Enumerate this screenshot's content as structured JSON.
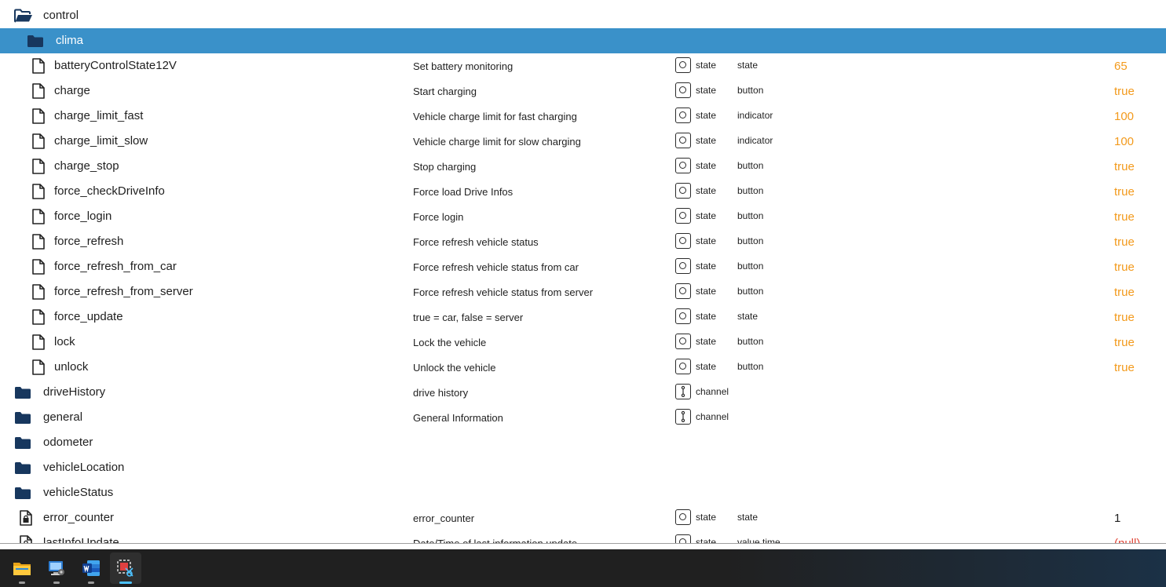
{
  "tree": [
    {
      "indent": 0,
      "icon": "folder-open",
      "name": "control",
      "desc": "",
      "type": "",
      "role": "",
      "value": "",
      "valueColor": ""
    },
    {
      "indent": 1,
      "icon": "folder",
      "name": "clima",
      "desc": "",
      "type": "",
      "role": "",
      "value": "",
      "valueColor": "",
      "selected": true
    },
    {
      "indent": 2,
      "icon": "file",
      "name": "batteryControlState12V",
      "desc": "Set battery monitoring",
      "type": "state",
      "role": "state",
      "value": "65",
      "valueColor": "orange"
    },
    {
      "indent": 2,
      "icon": "file",
      "name": "charge",
      "desc": "Start charging",
      "type": "state",
      "role": "button",
      "value": "true",
      "valueColor": "orange"
    },
    {
      "indent": 2,
      "icon": "file",
      "name": "charge_limit_fast",
      "desc": "Vehicle charge limit for fast charging",
      "type": "state",
      "role": "indicator",
      "value": "100",
      "valueColor": "orange"
    },
    {
      "indent": 2,
      "icon": "file",
      "name": "charge_limit_slow",
      "desc": "Vehicle charge limit for slow charging",
      "type": "state",
      "role": "indicator",
      "value": "100",
      "valueColor": "orange"
    },
    {
      "indent": 2,
      "icon": "file",
      "name": "charge_stop",
      "desc": "Stop charging",
      "type": "state",
      "role": "button",
      "value": "true",
      "valueColor": "orange"
    },
    {
      "indent": 2,
      "icon": "file",
      "name": "force_checkDriveInfo",
      "desc": "Force load Drive Infos",
      "type": "state",
      "role": "button",
      "value": "true",
      "valueColor": "orange"
    },
    {
      "indent": 2,
      "icon": "file",
      "name": "force_login",
      "desc": "Force login",
      "type": "state",
      "role": "button",
      "value": "true",
      "valueColor": "orange"
    },
    {
      "indent": 2,
      "icon": "file",
      "name": "force_refresh",
      "desc": "Force refresh vehicle status",
      "type": "state",
      "role": "button",
      "value": "true",
      "valueColor": "orange"
    },
    {
      "indent": 2,
      "icon": "file",
      "name": "force_refresh_from_car",
      "desc": "Force refresh vehicle status from car",
      "type": "state",
      "role": "button",
      "value": "true",
      "valueColor": "orange"
    },
    {
      "indent": 2,
      "icon": "file",
      "name": "force_refresh_from_server",
      "desc": "Force refresh vehicle status from server",
      "type": "state",
      "role": "button",
      "value": "true",
      "valueColor": "orange"
    },
    {
      "indent": 2,
      "icon": "file",
      "name": "force_update",
      "desc": "true = car, false = server",
      "type": "state",
      "role": "state",
      "value": "true",
      "valueColor": "orange"
    },
    {
      "indent": 2,
      "icon": "file",
      "name": "lock",
      "desc": "Lock the vehicle",
      "type": "state",
      "role": "button",
      "value": "true",
      "valueColor": "orange"
    },
    {
      "indent": 2,
      "icon": "file",
      "name": "unlock",
      "desc": "Unlock the vehicle",
      "type": "state",
      "role": "button",
      "value": "true",
      "valueColor": "orange"
    },
    {
      "indent": 0,
      "icon": "folder",
      "name": "driveHistory",
      "desc": "drive history",
      "type": "channel",
      "role": "",
      "value": "",
      "valueColor": ""
    },
    {
      "indent": 0,
      "icon": "folder",
      "name": "general",
      "desc": "General Information",
      "type": "channel",
      "role": "",
      "value": "",
      "valueColor": ""
    },
    {
      "indent": 0,
      "icon": "folder",
      "name": "odometer",
      "desc": "",
      "type": "",
      "role": "",
      "value": "",
      "valueColor": ""
    },
    {
      "indent": 0,
      "icon": "folder",
      "name": "vehicleLocation",
      "desc": "",
      "type": "",
      "role": "",
      "value": "",
      "valueColor": ""
    },
    {
      "indent": 0,
      "icon": "folder",
      "name": "vehicleStatus",
      "desc": "",
      "type": "",
      "role": "",
      "value": "",
      "valueColor": ""
    },
    {
      "indent": 0,
      "icon": "file-lock",
      "name": "error_counter",
      "desc": "error_counter",
      "type": "state",
      "role": "state",
      "value": "1",
      "valueColor": "dark"
    },
    {
      "indent": 0,
      "icon": "file-lock",
      "name": "lastInfoUpdate",
      "desc": "Date/Time of last information update",
      "type": "state",
      "role": "value.time",
      "value": "(null)",
      "valueColor": "red"
    }
  ],
  "taskbar": [
    {
      "icon": "file-explorer-icon",
      "active": false
    },
    {
      "icon": "remote-desktop-icon",
      "active": false
    },
    {
      "icon": "word-icon",
      "active": false
    },
    {
      "icon": "snipping-tool-icon",
      "active": true
    }
  ]
}
